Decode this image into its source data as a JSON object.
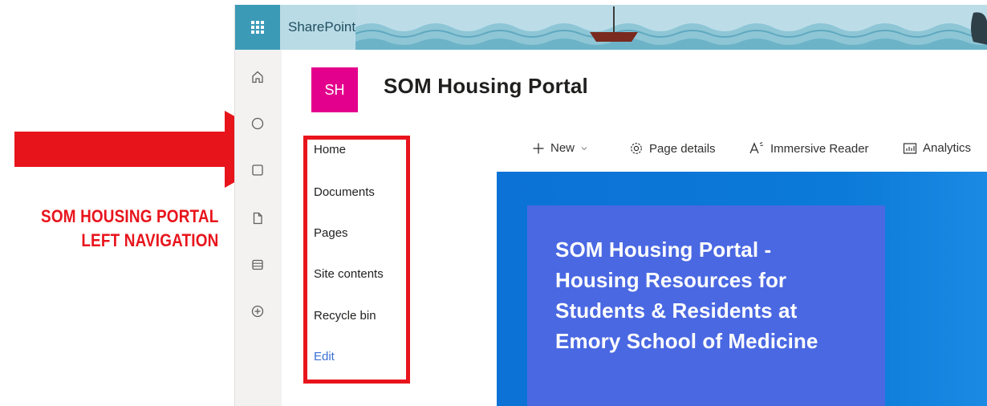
{
  "annotation": {
    "line1": "SOM HOUSING PORTAL",
    "line2": "LEFT NAVIGATION",
    "color": "#e8141c"
  },
  "suite_bar": {
    "app_name": "SharePoint",
    "waffle_icon": "app-launcher-icon"
  },
  "app_bar": {
    "icons": [
      "home-icon",
      "globe-icon",
      "news-icon",
      "document-icon",
      "list-icon",
      "add-circle-icon"
    ]
  },
  "site": {
    "logo_initials": "SH",
    "logo_color": "#e3008c",
    "title": "SOM Housing Portal"
  },
  "left_nav": {
    "items": [
      {
        "label": "Home"
      },
      {
        "label": "Documents"
      },
      {
        "label": "Pages"
      },
      {
        "label": "Site contents"
      },
      {
        "label": "Recycle bin"
      }
    ],
    "edit_label": "Edit"
  },
  "command_bar": {
    "new_label": "New",
    "page_details_label": "Page details",
    "immersive_reader_label": "Immersive Reader",
    "analytics_label": "Analytics"
  },
  "hero": {
    "line1": "SOM Housing Portal -",
    "line2": "Housing Resources for",
    "line3": "Students & Residents at",
    "line4": "Emory School of Medicine"
  }
}
